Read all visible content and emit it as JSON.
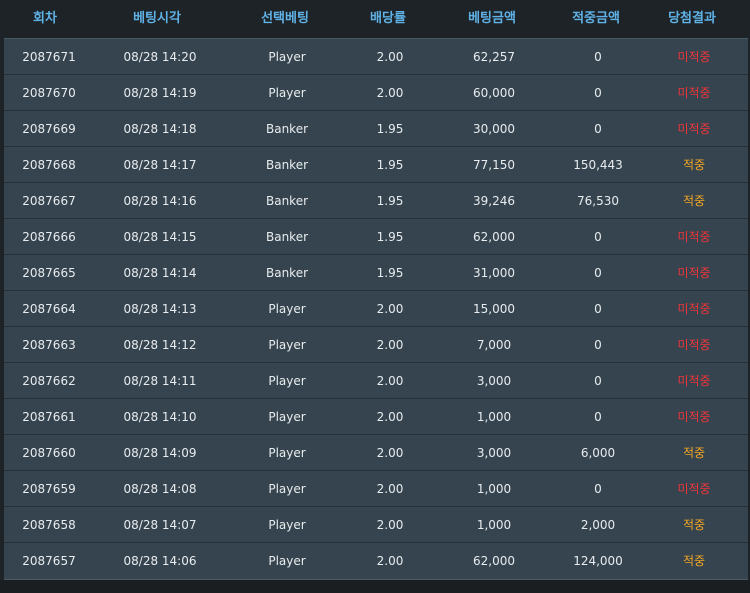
{
  "headers": [
    "회차",
    "베팅시각",
    "선택베팅",
    "배당률",
    "베팅금액",
    "적중금액",
    "당첨결과"
  ],
  "colors": {
    "header_text": "#5fb2e6",
    "row_bg": "#35444e",
    "miss": "#f0353b",
    "win": "#f5a623"
  },
  "rows": [
    {
      "round": "2087671",
      "time": "08/28 14:20",
      "pick": "Player",
      "odds": "2.00",
      "bet": "62,257",
      "payout": "0",
      "result": "미적중",
      "status": "miss"
    },
    {
      "round": "2087670",
      "time": "08/28 14:19",
      "pick": "Player",
      "odds": "2.00",
      "bet": "60,000",
      "payout": "0",
      "result": "미적중",
      "status": "miss"
    },
    {
      "round": "2087669",
      "time": "08/28 14:18",
      "pick": "Banker",
      "odds": "1.95",
      "bet": "30,000",
      "payout": "0",
      "result": "미적중",
      "status": "miss"
    },
    {
      "round": "2087668",
      "time": "08/28 14:17",
      "pick": "Banker",
      "odds": "1.95",
      "bet": "77,150",
      "payout": "150,443",
      "result": "적중",
      "status": "win"
    },
    {
      "round": "2087667",
      "time": "08/28 14:16",
      "pick": "Banker",
      "odds": "1.95",
      "bet": "39,246",
      "payout": "76,530",
      "result": "적중",
      "status": "win"
    },
    {
      "round": "2087666",
      "time": "08/28 14:15",
      "pick": "Banker",
      "odds": "1.95",
      "bet": "62,000",
      "payout": "0",
      "result": "미적중",
      "status": "miss"
    },
    {
      "round": "2087665",
      "time": "08/28 14:14",
      "pick": "Banker",
      "odds": "1.95",
      "bet": "31,000",
      "payout": "0",
      "result": "미적중",
      "status": "miss"
    },
    {
      "round": "2087664",
      "time": "08/28 14:13",
      "pick": "Player",
      "odds": "2.00",
      "bet": "15,000",
      "payout": "0",
      "result": "미적중",
      "status": "miss"
    },
    {
      "round": "2087663",
      "time": "08/28 14:12",
      "pick": "Player",
      "odds": "2.00",
      "bet": "7,000",
      "payout": "0",
      "result": "미적중",
      "status": "miss"
    },
    {
      "round": "2087662",
      "time": "08/28 14:11",
      "pick": "Player",
      "odds": "2.00",
      "bet": "3,000",
      "payout": "0",
      "result": "미적중",
      "status": "miss"
    },
    {
      "round": "2087661",
      "time": "08/28 14:10",
      "pick": "Player",
      "odds": "2.00",
      "bet": "1,000",
      "payout": "0",
      "result": "미적중",
      "status": "miss"
    },
    {
      "round": "2087660",
      "time": "08/28 14:09",
      "pick": "Player",
      "odds": "2.00",
      "bet": "3,000",
      "payout": "6,000",
      "result": "적중",
      "status": "win"
    },
    {
      "round": "2087659",
      "time": "08/28 14:08",
      "pick": "Player",
      "odds": "2.00",
      "bet": "1,000",
      "payout": "0",
      "result": "미적중",
      "status": "miss"
    },
    {
      "round": "2087658",
      "time": "08/28 14:07",
      "pick": "Player",
      "odds": "2.00",
      "bet": "1,000",
      "payout": "2,000",
      "result": "적중",
      "status": "win"
    },
    {
      "round": "2087657",
      "time": "08/28 14:06",
      "pick": "Player",
      "odds": "2.00",
      "bet": "62,000",
      "payout": "124,000",
      "result": "적중",
      "status": "win"
    }
  ]
}
